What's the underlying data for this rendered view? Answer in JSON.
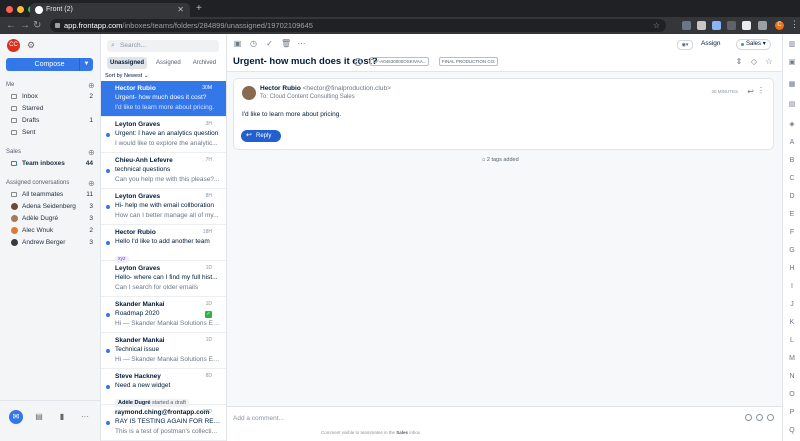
{
  "browser": {
    "tab_title": "Front (2)",
    "url_host": "app.frontapp.com",
    "url_path": "/inboxes/teams/folders/284899/unassigned/19702109645",
    "profile_initial": "C"
  },
  "leftnav": {
    "compose_label": "Compose",
    "me_header": "Me",
    "me_items": [
      {
        "label": "Inbox",
        "count": "2"
      },
      {
        "label": "Starred",
        "count": ""
      },
      {
        "label": "Drafts",
        "count": "1"
      },
      {
        "label": "Sent",
        "count": ""
      }
    ],
    "sales_header": "Sales",
    "team_inboxes": {
      "label": "Team inboxes",
      "count": "44"
    },
    "assigned_header": "Assigned conversations",
    "assigned_items": [
      {
        "label": "All teammates",
        "count": "11"
      },
      {
        "label": "Adena Seidenberg",
        "count": "3"
      },
      {
        "label": "Adèle Dugré",
        "count": "3"
      },
      {
        "label": "Alec Wnuk",
        "count": "2"
      },
      {
        "label": "Andrew Berger",
        "count": "3"
      }
    ]
  },
  "list": {
    "search_placeholder": "Search...",
    "tabs": [
      "Unassigned",
      "Assigned",
      "Archived"
    ],
    "sort_label": "Sort by Newest",
    "conversations": [
      {
        "name": "Hector Rubio",
        "time": "30M",
        "subject": "Urgent- how much does it cost?",
        "preview": "I'd like to learn more about pricing."
      },
      {
        "name": "Leyton Graves",
        "time": "3H",
        "subject": "Urgent: I have an analytics question",
        "preview": "I would like to explore the analytic..."
      },
      {
        "name": "Chieu-Anh Lefevre",
        "time": "7H",
        "subject": "technical questions",
        "preview": "Can you help me with this please?..."
      },
      {
        "name": "Leyton Graves",
        "time": "8H",
        "subject": "Hi- help me with email collboration",
        "preview": "How can I better manage all of my..."
      },
      {
        "name": "Hector Rubio",
        "time": "18H",
        "subject": "Hello I'd like to add another team",
        "tag": "xyz"
      },
      {
        "name": "Leyton Graves",
        "time": "1D",
        "subject": "Hello- where can I find my full hist...",
        "preview": "Can I search for older emails"
      },
      {
        "name": "Skander Mankai",
        "time": "1D",
        "subject": "Roadmap 2020",
        "preview": "Hi — Skander Mankai Solutions En..."
      },
      {
        "name": "Skander Mankai",
        "time": "1D",
        "subject": "Technical issue",
        "preview": "Hi — Skander Mankai Solutions En..."
      },
      {
        "name": "Steve Hackney",
        "time": "8D",
        "subject": "Need a new widget",
        "draft_author": "Adèle Dugré",
        "draft_text": "started a draft"
      },
      {
        "name": "raymond.ching@frontapp.com",
        "time": "13D",
        "subject": "RAY IS TESTING AGAIN FOR REAL...",
        "preview": "This is a test of postman's collecti..."
      }
    ]
  },
  "main": {
    "assign_label": "Assign",
    "inbox_pill": "Sales",
    "subject": "Urgent- how much does it cost?",
    "badges": [
      "SF-A04630000OSKIVAA...",
      "FINAL PRODUCTION CO."
    ],
    "message": {
      "from_name": "Hector Rubio",
      "from_email": "<hector@finalproduction.club>",
      "to": "To: Cloud Content Consulting Sales",
      "time": "30 MINUTES",
      "body": "I'd like to learn more about pricing.",
      "reply_label": "Reply"
    },
    "tags_added": "2 tags added",
    "composer_placeholder": "Add a comment...",
    "composer_note_prefix": "Comment visible to teammates in the",
    "composer_note_inbox": "Sales",
    "composer_note_suffix": "inbox"
  },
  "rail_letters": [
    "A",
    "B",
    "C",
    "D",
    "E",
    "F",
    "G",
    "H",
    "I",
    "J",
    "K",
    "L",
    "M",
    "N",
    "O",
    "P",
    "Q"
  ]
}
